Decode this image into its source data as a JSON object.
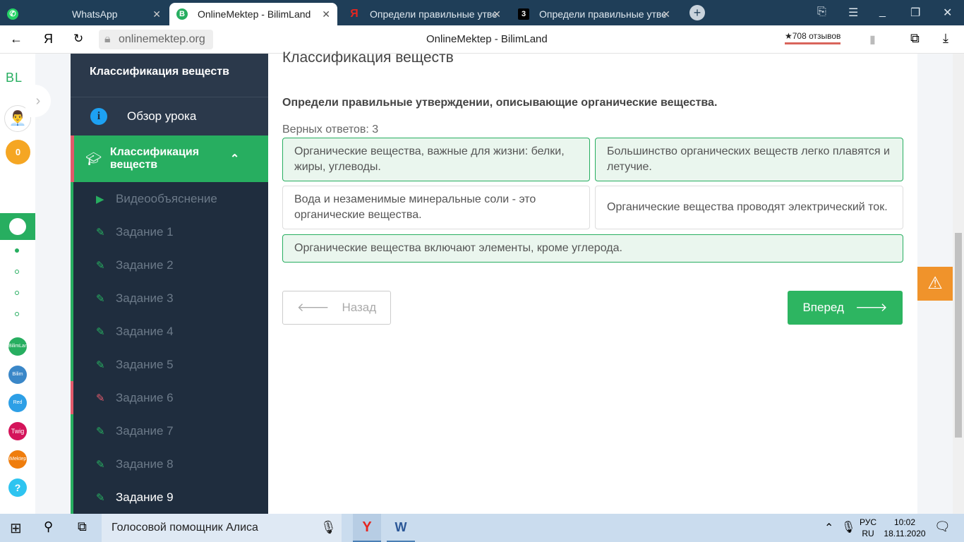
{
  "browser": {
    "tabs": [
      {
        "label": "WhatsApp",
        "icon": "whatsapp-icon"
      },
      {
        "label": "OnlineMektep - BilimLand",
        "icon": "bilimland-icon",
        "active": true
      },
      {
        "label": "Определи правильные утве",
        "icon": "yandex-icon"
      },
      {
        "label": "Определи правильные утве",
        "icon": "znanija-icon"
      }
    ],
    "url": "onlinemektep.org",
    "page_title": "OnlineMektep - BilimLand",
    "reviews": "★708 отзывов"
  },
  "rail": {
    "logo": "BL",
    "points": "0",
    "apps": [
      "BilimLand",
      "Bilim Book",
      "Red",
      "Twig",
      "iMektep",
      "?"
    ]
  },
  "sidebar": {
    "header": "Классификация веществ",
    "overview": "Обзор урока",
    "active_section": "Классификация веществ",
    "items": [
      "Видеообъяснение",
      "Задание 1",
      "Задание 2",
      "Задание 3",
      "Задание 4",
      "Задание 5",
      "Задание 6",
      "Задание 7",
      "Задание 8",
      "Задание 9"
    ]
  },
  "main": {
    "title": "Классификация веществ",
    "question": "Определи правильные утверждении, описывающие органические вещества.",
    "correct_count": "Верных ответов: 3",
    "options": [
      {
        "text": "Органические вещества, важные для жизни: белки, жиры, углеводы.",
        "selected": true
      },
      {
        "text": "Большинство органических веществ легко плавятся и летучие.",
        "selected": true
      },
      {
        "text": "Вода и незаменимые минеральные соли - это органические вещества.",
        "selected": false
      },
      {
        "text": "Органические вещества проводят электрический ток.",
        "selected": false
      },
      {
        "text": "Органические вещества включают элементы, кроме углерода.",
        "selected": true
      }
    ],
    "back": "Назад",
    "next": "Вперед"
  },
  "taskbar": {
    "search": "Голосовой помощник Алиса",
    "lang1": "РУС",
    "lang2": "RU",
    "time": "10:02",
    "date": "18.11.2020"
  }
}
